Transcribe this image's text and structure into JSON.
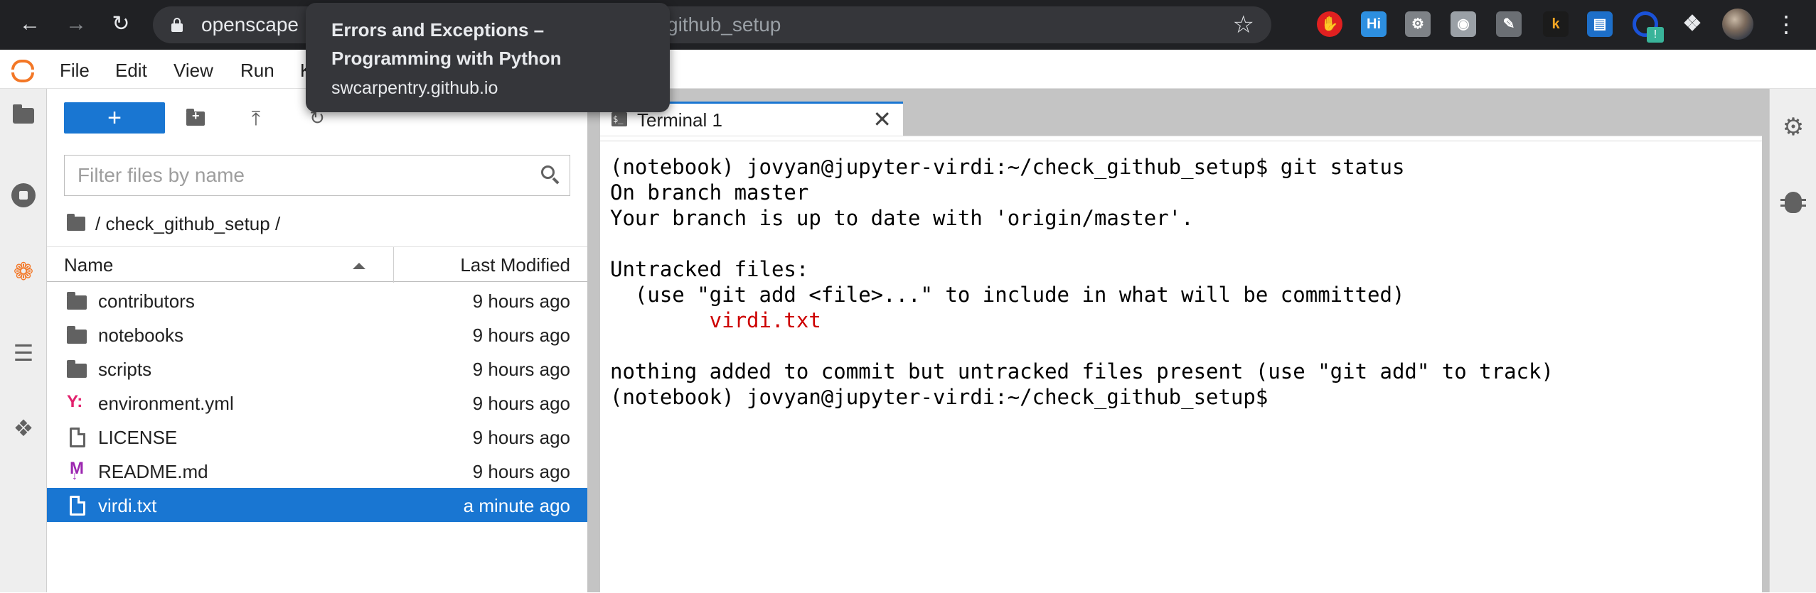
{
  "browser": {
    "url_host": "openscape",
    "url_path": "github_setup",
    "tooltip": {
      "title_line1": "Errors and Exceptions –",
      "title_line2": "Programming with Python",
      "host": "swcarpentry.github.io"
    },
    "extensions": [
      {
        "name": "hand-stop-extension",
        "glyph": "✋"
      },
      {
        "name": "highlight-extension",
        "glyph": "Hi"
      },
      {
        "name": "wrench-extension",
        "glyph": "⚙"
      },
      {
        "name": "camera-extension",
        "glyph": "◉"
      },
      {
        "name": "pen-extension",
        "glyph": "✎"
      },
      {
        "name": "k-extension",
        "glyph": "k"
      },
      {
        "name": "reader-extension",
        "glyph": "▤"
      }
    ],
    "ext_badge": "!"
  },
  "menu": [
    "File",
    "Edit",
    "View",
    "Run",
    "K"
  ],
  "filebrowser": {
    "new_label": "+",
    "filter_placeholder": "Filter files by name",
    "breadcrumb": "/ check_github_setup /",
    "col_name": "Name",
    "col_modified": "Last Modified",
    "files": [
      {
        "name": "contributors",
        "modified": "9 hours ago",
        "type": "folder",
        "selected": false
      },
      {
        "name": "notebooks",
        "modified": "9 hours ago",
        "type": "folder",
        "selected": false
      },
      {
        "name": "scripts",
        "modified": "9 hours ago",
        "type": "folder",
        "selected": false
      },
      {
        "name": "environment.yml",
        "modified": "9 hours ago",
        "type": "yaml",
        "selected": false
      },
      {
        "name": "LICENSE",
        "modified": "9 hours ago",
        "type": "file",
        "selected": false
      },
      {
        "name": "README.md",
        "modified": "9 hours ago",
        "type": "markdown",
        "selected": false
      },
      {
        "name": "virdi.txt",
        "modified": "a minute ago",
        "type": "file",
        "selected": true
      }
    ]
  },
  "terminal": {
    "tab_label": "Terminal 1",
    "tab_icon_text": "$_",
    "lines": [
      {
        "text": "(notebook) jovyan@jupyter-virdi:~/check_github_setup$ git status",
        "color": "normal"
      },
      {
        "text": "On branch master",
        "color": "normal"
      },
      {
        "text": "Your branch is up to date with 'origin/master'.",
        "color": "normal"
      },
      {
        "text": "",
        "color": "normal"
      },
      {
        "text": "Untracked files:",
        "color": "normal"
      },
      {
        "text": "  (use \"git add <file>...\" to include in what will be committed)",
        "color": "normal"
      },
      {
        "text": "        virdi.txt",
        "color": "red"
      },
      {
        "text": "",
        "color": "normal"
      },
      {
        "text": "nothing added to commit but untracked files present (use \"git add\" to track)",
        "color": "normal"
      },
      {
        "text": "(notebook) jovyan@jupyter-virdi:~/check_github_setup$",
        "color": "normal"
      }
    ]
  },
  "colors": {
    "accent": "#1976d2",
    "jupyter_orange": "#f37726",
    "terminal_red": "#cd0000"
  }
}
